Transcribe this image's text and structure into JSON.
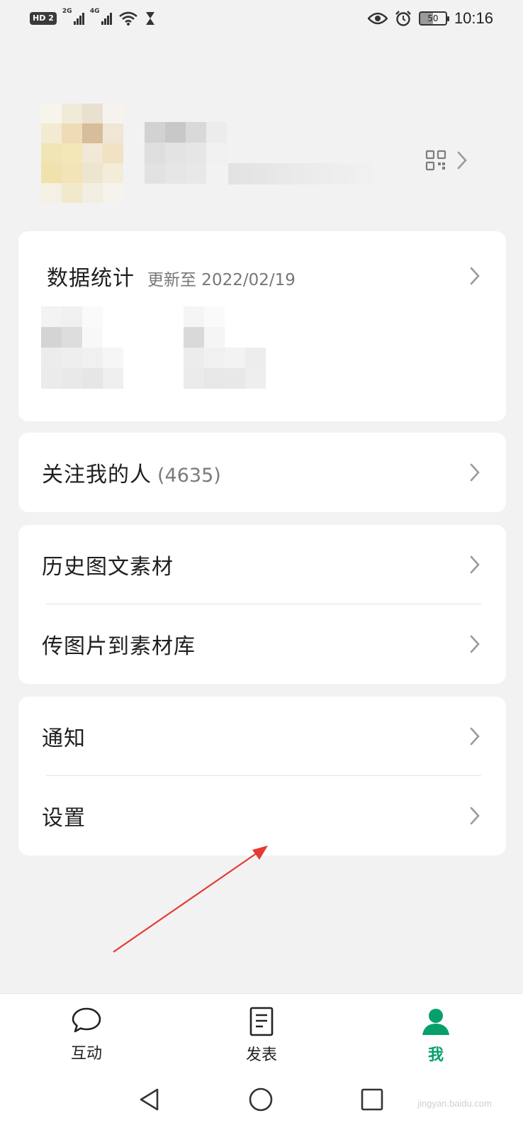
{
  "status_bar": {
    "hd_label": "HD",
    "sim_label": "2",
    "signal1_label": "2G",
    "signal2_label": "4G",
    "battery": "50",
    "time": "10:16"
  },
  "stats_card": {
    "title": "数据统计",
    "updated": "更新至 2022/02/19"
  },
  "followers_card": {
    "label": "关注我的人",
    "count": "(4635)"
  },
  "material_card": {
    "items": [
      {
        "label": "历史图文素材"
      },
      {
        "label": "传图片到素材库"
      }
    ]
  },
  "settings_card": {
    "items": [
      {
        "label": "通知"
      },
      {
        "label": "设置"
      }
    ]
  },
  "bottom_nav": {
    "items": [
      {
        "label": "互动",
        "icon": "chat-bubble-icon"
      },
      {
        "label": "发表",
        "icon": "document-icon"
      },
      {
        "label": "我",
        "icon": "person-icon",
        "active": true
      }
    ]
  },
  "colors": {
    "accent": "#07a06a",
    "annotation_arrow": "#e53935"
  },
  "watermark": "jingyan.baidu.com"
}
